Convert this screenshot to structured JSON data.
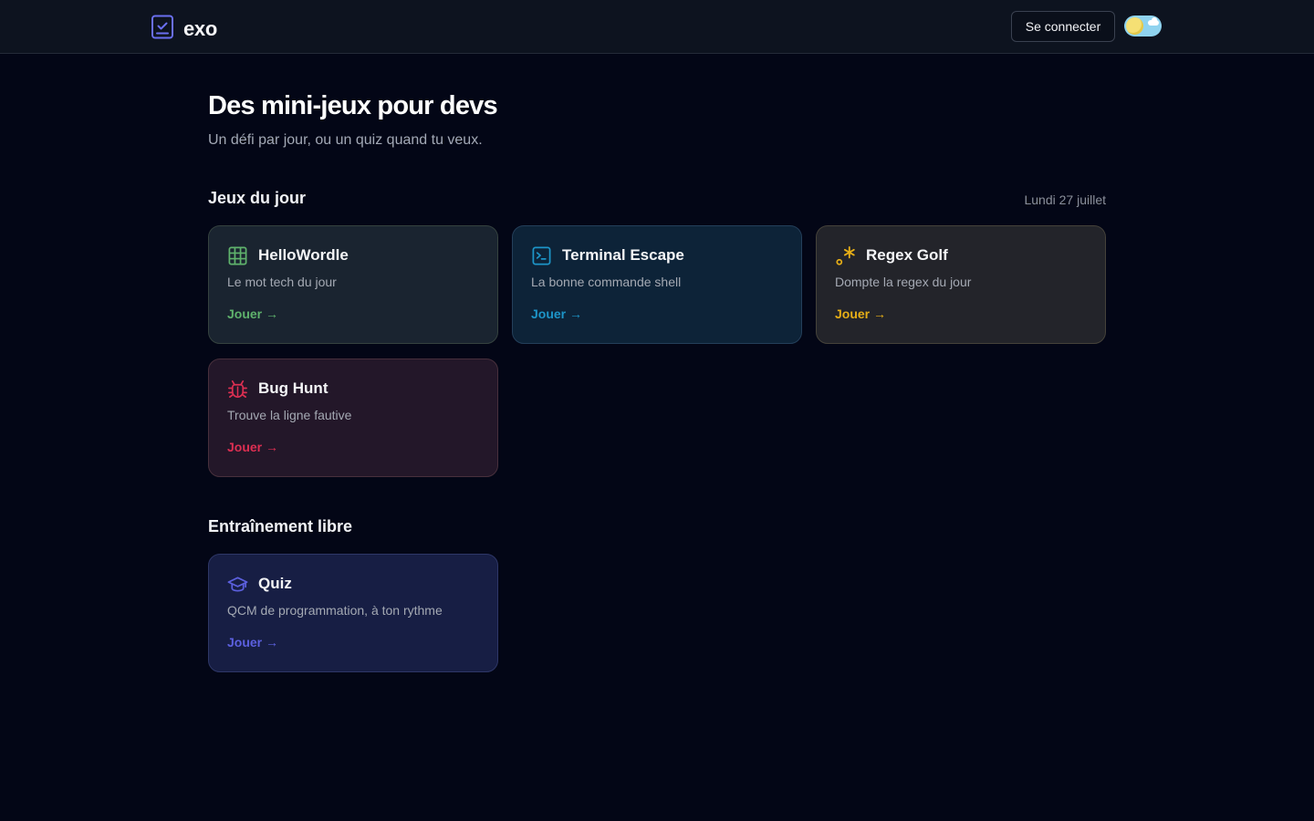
{
  "header": {
    "logo_text": "exo",
    "login_label": "Se connecter",
    "theme_toggle_icon": "sun-toggle-icon"
  },
  "hero": {
    "title": "Des mini-jeux pour devs",
    "subtitle": "Un défi par jour, ou un quiz quand tu veux."
  },
  "daily": {
    "title": "Jeux du jour",
    "date": "Lundi 27 juillet",
    "games": [
      {
        "name": "HelloWordle",
        "description": "Le mot tech du jour",
        "play_label": "Jouer →",
        "icon": "grid-icon",
        "accent": "#5fb26c"
      },
      {
        "name": "Terminal Escape",
        "description": "La bonne commande shell",
        "play_label": "Jouer →",
        "icon": "terminal-icon",
        "accent": "#1d95c8"
      },
      {
        "name": "Regex Golf",
        "description": "Dompte la regex du jour",
        "play_label": "Jouer →",
        "icon": "regex-icon",
        "accent": "#e6ae17"
      },
      {
        "name": "Bug Hunt",
        "description": "Trouve la ligne fautive",
        "play_label": "Jouer →",
        "icon": "bug-icon",
        "accent": "#dd2f52"
      }
    ]
  },
  "free": {
    "title": "Entraînement libre",
    "games": [
      {
        "name": "Quiz",
        "description": "QCM de programmation, à ton rythme",
        "play_label": "Jouer →",
        "icon": "graduation-cap-icon",
        "accent": "#5c60df"
      }
    ]
  }
}
